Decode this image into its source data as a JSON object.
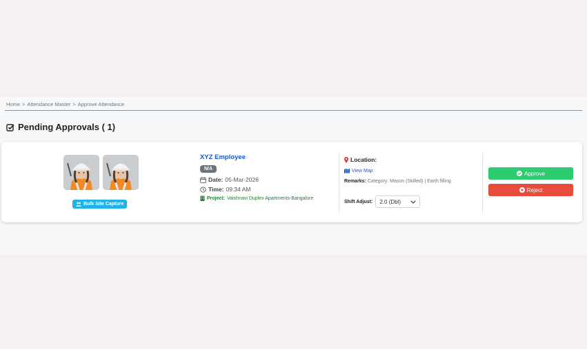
{
  "breadcrumb": {
    "items": [
      "Home",
      "Attendance Master",
      "Approve Attendance"
    ],
    "separator": ">"
  },
  "page": {
    "title": "Pending Approvals ( 1)"
  },
  "approval": {
    "bulk_label": "Bulk Site Capture",
    "employee_name": "XYZ Employee",
    "badge": "N/A",
    "date_label": "Date:",
    "date_value": "05-Mar-2026",
    "time_label": "Time:",
    "time_value": "09:34 AM",
    "project_label": "Project:",
    "project_value": "Vaishnavi Duplex Apartments-Bangalore",
    "location_label": "Location:",
    "view_map": "View Map",
    "remarks_label": "Remarks:",
    "remarks_value": "Category: Mason (Skilled) | Earth filling",
    "shift_label": "Shift Adjust:",
    "shift_value": "2.0 (Dbl)",
    "approve_label": "Approve",
    "reject_label": "Reject"
  },
  "colors": {
    "link": "#1557d6",
    "approve": "#2ecc71",
    "reject": "#e74c3c",
    "bulk": "#1fb3e8",
    "project": "#1e7e34",
    "location_pin": "#e23b3b"
  },
  "icons": {
    "title": "check-square-icon",
    "bulk": "users-icon",
    "date": "calendar-icon",
    "time": "clock-icon",
    "project": "building-icon",
    "location": "map-marker-icon",
    "map": "map-icon",
    "select": "chevron-down-icon",
    "approve": "check-circle-icon",
    "reject": "times-circle-icon"
  }
}
